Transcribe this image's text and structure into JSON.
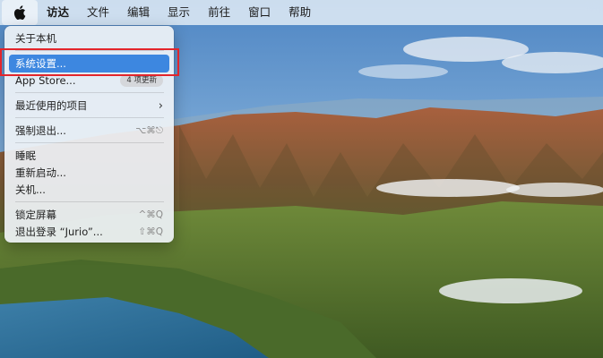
{
  "menubar": {
    "apple_icon": "apple-logo-icon",
    "items": [
      "访达",
      "文件",
      "编辑",
      "显示",
      "前往",
      "窗口",
      "帮助"
    ]
  },
  "apple_menu": {
    "items": [
      {
        "label": "关于本机"
      },
      {
        "label": "系统设置...",
        "selected": true
      },
      {
        "label": "App Store...",
        "badge": "4 项更新"
      },
      {
        "label": "最近使用的项目",
        "submenu_icon": "chevron-right-icon"
      },
      {
        "label": "强制退出...",
        "shortcut": "⌥⌘⎋"
      },
      {
        "label": "睡眠"
      },
      {
        "label": "重新启动..."
      },
      {
        "label": "关机..."
      },
      {
        "label": "锁定屏幕",
        "shortcut": "^⌘Q"
      },
      {
        "label": "退出登录 “Jurio”...",
        "shortcut": "⇧⌘Q"
      }
    ]
  },
  "colors": {
    "highlight": "#3d87e0",
    "annotation_box": "#e3252b"
  }
}
